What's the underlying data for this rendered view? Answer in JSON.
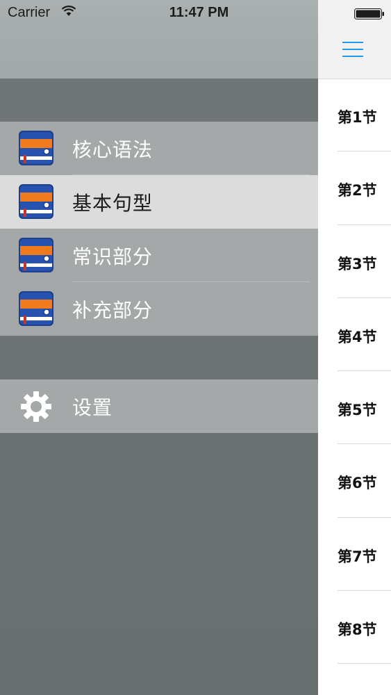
{
  "status_bar": {
    "carrier": "Carrier",
    "time": "11:47 PM"
  },
  "drawer": {
    "books": [
      {
        "label": "核心语法",
        "icon": "book-icon",
        "selected": false
      },
      {
        "label": "基本句型",
        "icon": "book-icon",
        "selected": true
      },
      {
        "label": "常识部分",
        "icon": "book-icon",
        "selected": false
      },
      {
        "label": "补充部分",
        "icon": "book-icon",
        "selected": false
      }
    ],
    "settings": {
      "label": "设置",
      "icon": "gear-icon"
    }
  },
  "panel": {
    "menu_icon": "hamburger-icon",
    "accent_color": "#1e9bf0",
    "sections": [
      "第1节",
      "第2节",
      "第3节",
      "第4节",
      "第5节",
      "第6节",
      "第7节",
      "第8节"
    ]
  }
}
